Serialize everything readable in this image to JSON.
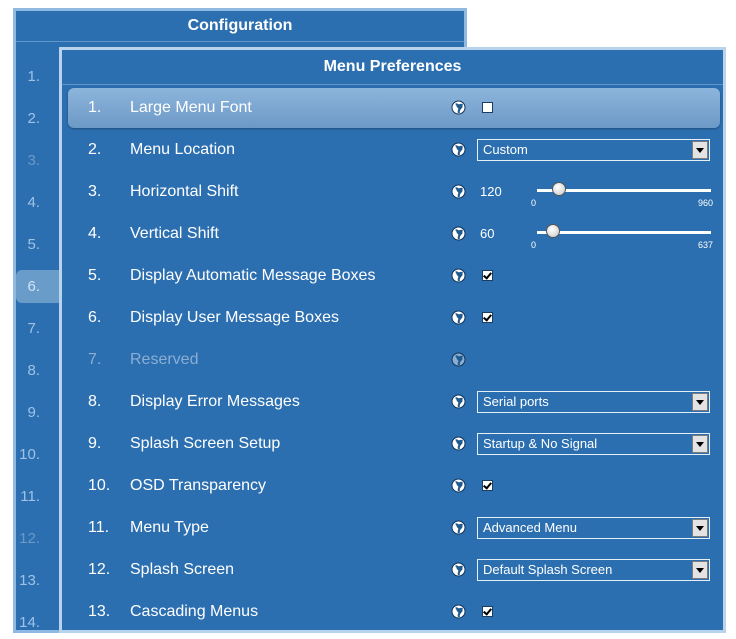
{
  "config": {
    "title": "Configuration",
    "rows": [
      {
        "num": "1.",
        "dim": false,
        "selected": false
      },
      {
        "num": "2.",
        "dim": false,
        "selected": false
      },
      {
        "num": "3.",
        "dim": true,
        "selected": false
      },
      {
        "num": "4.",
        "dim": false,
        "selected": false
      },
      {
        "num": "5.",
        "dim": false,
        "selected": false
      },
      {
        "num": "6.",
        "dim": false,
        "selected": true
      },
      {
        "num": "7.",
        "dim": false,
        "selected": false
      },
      {
        "num": "8.",
        "dim": false,
        "selected": false
      },
      {
        "num": "9.",
        "dim": false,
        "selected": false
      },
      {
        "num": "10.",
        "dim": false,
        "selected": false
      },
      {
        "num": "11.",
        "dim": false,
        "selected": false
      },
      {
        "num": "12.",
        "dim": true,
        "selected": false
      },
      {
        "num": "13.",
        "dim": false,
        "selected": false
      },
      {
        "num": "14.",
        "dim": false,
        "selected": false
      }
    ]
  },
  "prefs": {
    "title": "Menu Preferences",
    "items": [
      {
        "num": "1.",
        "label": "Large Menu Font",
        "control": "checkbox",
        "checked": false,
        "selected": true
      },
      {
        "num": "2.",
        "label": "Menu Location",
        "control": "select",
        "value": "Custom"
      },
      {
        "num": "3.",
        "label": "Horizontal Shift",
        "control": "slider",
        "value": "120",
        "min": "0",
        "max": "960",
        "fraction": 0.125
      },
      {
        "num": "4.",
        "label": "Vertical Shift",
        "control": "slider",
        "value": "60",
        "min": "0",
        "max": "637",
        "fraction": 0.094
      },
      {
        "num": "5.",
        "label": "Display Automatic Message Boxes",
        "control": "checkbox",
        "checked": true
      },
      {
        "num": "6.",
        "label": "Display User Message Boxes",
        "control": "checkbox",
        "checked": true
      },
      {
        "num": "7.",
        "label": "Reserved",
        "control": "none",
        "disabled": true
      },
      {
        "num": "8.",
        "label": "Display Error Messages",
        "control": "select",
        "value": "Serial ports"
      },
      {
        "num": "9.",
        "label": "Splash Screen Setup",
        "control": "select",
        "value": "Startup & No Signal"
      },
      {
        "num": "10.",
        "label": "OSD Transparency",
        "control": "checkbox",
        "checked": true
      },
      {
        "num": "11.",
        "label": "Menu Type",
        "control": "select",
        "value": "Advanced Menu"
      },
      {
        "num": "12.",
        "label": "Splash Screen",
        "control": "select",
        "value": "Default Splash Screen"
      },
      {
        "num": "13.",
        "label": "Cascading Menus",
        "control": "checkbox",
        "checked": true
      }
    ]
  },
  "icons": {
    "row_icon": "globe-icon"
  },
  "colors": {
    "panel": "#2c6fb0",
    "selection": "#7ea9d4",
    "text": "#ffffff",
    "disabled_text": "#8aaed3"
  }
}
